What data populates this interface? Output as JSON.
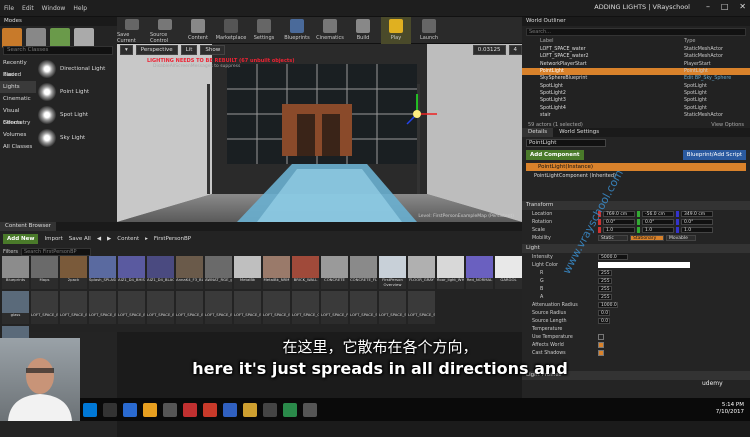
{
  "menubar": {
    "items": [
      "File",
      "Edit",
      "Window",
      "Help"
    ],
    "title": "ADDING LIGHTS | VRayschool"
  },
  "modes": {
    "tab_label": "Modes",
    "search_placeholder": "Search Classes",
    "categories": [
      "Recently Placed",
      "Basic",
      "Lights",
      "Cinematic",
      "Visual Effects",
      "Geometry",
      "Volumes",
      "All Classes"
    ],
    "selected_category": "Lights",
    "lights": [
      "Directional Light",
      "Point Light",
      "Spot Light",
      "Sky Light"
    ]
  },
  "toolbar": {
    "buttons": [
      "Save Current",
      "Source Control",
      "Content",
      "Marketplace",
      "Settings",
      "Blueprints",
      "Cinematics",
      "Build",
      "Play",
      "Launch"
    ]
  },
  "viewport": {
    "perspective_label": "Perspective",
    "lit_label": "Lit",
    "show_label": "Show",
    "grid_value": "0.03125",
    "warning": "LIGHTING NEEDS TO BE REBUILT (67 unbuilt objects)",
    "warning_sub": "DisableAllScreenMessages to suppress",
    "footer": "Level: FirstPersonExampleMap (Persistent)"
  },
  "content_browser": {
    "tab_label": "Content Browser",
    "add_new": "Add New",
    "import": "Import",
    "save_all": "Save All",
    "breadcrumb": [
      "Content",
      "FirstPersonBP"
    ],
    "filters": "Filters",
    "search_placeholder": "Search FirstPersonBP",
    "row1": [
      "Blueprints",
      "Maps",
      "2pack",
      "Splash_SPLASH",
      "AIZ1_D4_BHISS",
      "AIZ1_D4_BLACK_ARM",
      "AnnaK4_F3_BLACK_orig",
      "AWNAT_RGE_ground_NORMAL",
      "MetalBk",
      "MetalBk_NRM",
      "BRICK_WALL",
      "CONCRETE",
      "CONCRETE_FLOOR",
      "FirstPerson Overview",
      "FLOOR_GRAY",
      "floor_light_WHITE",
      "Red_NORMAL",
      "GARGOL"
    ],
    "row2": [
      "glass",
      "LOFT_SPACE_BLACK_METAL",
      "LOFT_SPACE_BLACK_METAL",
      "LOFT_SPACE_BLACK_METAL",
      "LOFT_SPACE_BLACK_METAL",
      "LOFT_SPACE_BLACK_METAL",
      "LOFT_SPACE_BLACK_METAL",
      "LOFT_SPACE_BLACK_METAL",
      "LOFT_SPACE_BLACK_METAL",
      "LOFT_SPACE_BLACK_METAL",
      "LOFT_SPACE_GLASS",
      "LOFT_SPACE_PLANTER",
      "LOFT_SPACE_SCULPTURE",
      "LOFT_SPACE_SECOND_FLOOR",
      "LOFT_SPACE_STEEL_METAL"
    ],
    "row3": [
      "LOFT_SPACE_BLACK_METAL"
    ]
  },
  "outliner": {
    "tab_label": "World Outliner",
    "search_placeholder": "Search...",
    "col_label": "Label",
    "col_type": "Type",
    "rows": [
      {
        "label": "LOFT_SPACE_water",
        "type": "StaticMeshActor",
        "link": false
      },
      {
        "label": "LOFT_SPACE_water2",
        "type": "StaticMeshActor",
        "link": false
      },
      {
        "label": "NetworkPlayerStart",
        "type": "PlayerStart",
        "link": false
      },
      {
        "label": "PointLight",
        "type": "PointLight",
        "link": false,
        "selected": true
      },
      {
        "label": "SkySphereBlueprint",
        "type": "Edit BP_Sky_Sphere",
        "link": true
      },
      {
        "label": "SpotLight",
        "type": "SpotLight",
        "link": false
      },
      {
        "label": "SpotLight2",
        "type": "SpotLight",
        "link": false
      },
      {
        "label": "SpotLight3",
        "type": "SpotLight",
        "link": false
      },
      {
        "label": "SpotLight4",
        "type": "SpotLight",
        "link": false
      },
      {
        "label": "stair",
        "type": "StaticMeshActor",
        "link": false
      }
    ],
    "count": "59 actors (1 selected)",
    "view_options": "View Options"
  },
  "details": {
    "tab_label": "Details",
    "tab2_label": "World Settings",
    "name_value": "PointLight",
    "add_component": "Add Component",
    "blueprint_btn": "Blueprint/Add Script",
    "instance": "PointLight(Instance)",
    "component": "PointLightComponent (Inherited)",
    "transform": {
      "title": "Transform",
      "location_label": "Location",
      "location": [
        "769.0 cm",
        "-56.0 cm",
        "349.0 cm"
      ],
      "rotation_label": "Rotation",
      "rotation": [
        "0.0°",
        "0.0°",
        "0.0°"
      ],
      "scale_label": "Scale",
      "scale": [
        "1.0",
        "1.0",
        "1.0"
      ],
      "mobility_label": "Mobility",
      "mobility": [
        "Static",
        "Stationary",
        "Movable"
      ]
    },
    "light": {
      "title": "Light",
      "intensity_label": "Intensity",
      "intensity": "5000.0",
      "color_label": "Light Color",
      "r_label": "R",
      "r": "255",
      "g_label": "G",
      "g": "255",
      "b_label": "B",
      "b": "255",
      "a_label": "A",
      "a": "255",
      "atten_label": "Attenuation Radius",
      "atten": "1000.0",
      "srcr_label": "Source Radius",
      "srcr": "0.0",
      "srcl_label": "Source Length",
      "srcl": "0.0",
      "temp_label": "Temperature",
      "usetemp_label": "Use Temperature",
      "affects_label": "Affects World",
      "shadows_label": "Cast Shadows"
    },
    "profiles": "Light Profiles"
  },
  "subtitles": {
    "cn": "在这里，它散布在各个方向，",
    "en": "here it's just spreads in all directions and"
  },
  "watermark": "www.vrayschool.com",
  "udemy": "udemy",
  "clock": {
    "time": "5:14 PM",
    "date": "7/10/2017"
  },
  "colors": {
    "accent": "#d9822b",
    "green": "#4a7a2a",
    "blue": "#2a5aa0"
  }
}
